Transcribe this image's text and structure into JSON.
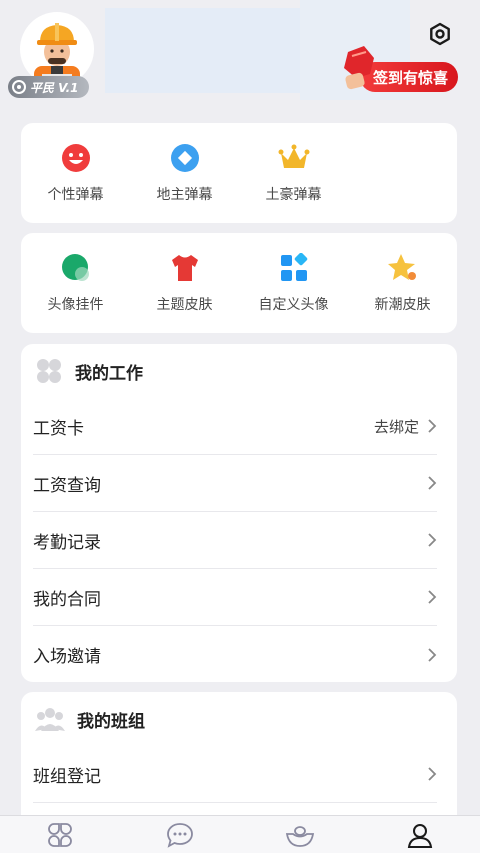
{
  "header": {
    "level_badge": "平民 V.1",
    "checkin_label": "签到有惊喜"
  },
  "danmu_row": {
    "items": [
      {
        "label": "个性弹幕",
        "icon": "smiley-face-icon",
        "color": "#f03c3c"
      },
      {
        "label": "地主弹幕",
        "icon": "blue-diamond-icon",
        "color": "#3ca0f0"
      },
      {
        "label": "土豪弹幕",
        "icon": "crown-icon",
        "color": "#f2b62a"
      }
    ]
  },
  "decor_row": {
    "items": [
      {
        "label": "头像挂件",
        "icon": "green-circle-icon",
        "color": "#1aa86a"
      },
      {
        "label": "主题皮肤",
        "icon": "tshirt-icon",
        "color": "#e53935"
      },
      {
        "label": "自定义头像",
        "icon": "grid-squares-icon",
        "color": "#2196f3"
      },
      {
        "label": "新潮皮肤",
        "icon": "star-icon",
        "color": "#f6c23e"
      }
    ]
  },
  "work": {
    "title": "我的工作",
    "items": [
      {
        "label": "工资卡",
        "value": "去绑定"
      },
      {
        "label": "工资查询"
      },
      {
        "label": "考勤记录"
      },
      {
        "label": "我的合同"
      },
      {
        "label": "入场邀请"
      }
    ]
  },
  "team": {
    "title": "我的班组",
    "items": [
      {
        "label": "班组登记"
      }
    ]
  },
  "tabbar": {
    "tabs": [
      {
        "icon": "clover-icon"
      },
      {
        "icon": "chat-bubble-icon"
      },
      {
        "icon": "ingot-icon"
      },
      {
        "icon": "profile-icon",
        "active": true
      }
    ]
  }
}
